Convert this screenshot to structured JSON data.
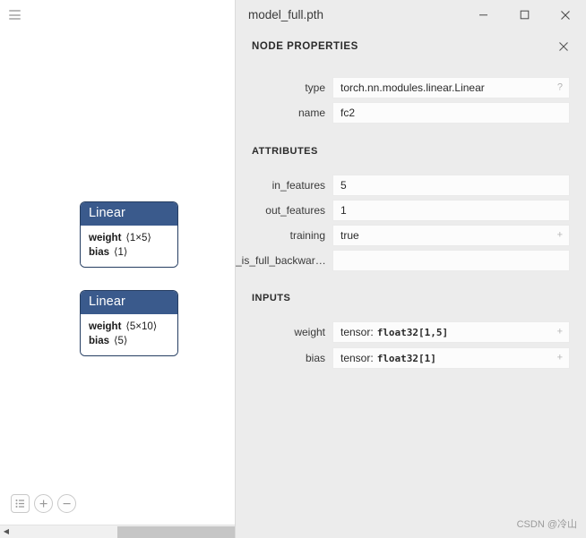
{
  "window": {
    "title": "model_full.pth",
    "minimize_label": "—",
    "maximize_label": "□",
    "close_label": "✕"
  },
  "canvas": {
    "menu_icon": "hamburger-icon",
    "toolbar": {
      "list_icon": "list-icon",
      "zoom_in_label": "+",
      "zoom_out_label": "−"
    },
    "scrollbar": {
      "left_arrow": "◀",
      "right_arrow": "▶"
    },
    "nodes": [
      {
        "title": "Linear",
        "attributes": [
          {
            "key": "weight",
            "value": "⟨1×5⟩"
          },
          {
            "key": "bias",
            "value": "⟨1⟩"
          }
        ]
      },
      {
        "title": "Linear",
        "attributes": [
          {
            "key": "weight",
            "value": "⟨5×10⟩"
          },
          {
            "key": "bias",
            "value": "⟨5⟩"
          }
        ]
      }
    ]
  },
  "panel": {
    "header_title": "NODE PROPERTIES",
    "close_label": "✕",
    "top_fields": [
      {
        "label": "type",
        "value": "torch.nn.modules.linear.Linear",
        "affix": "?",
        "affix_name": "help-icon"
      },
      {
        "label": "name",
        "value": "fc2",
        "affix": "",
        "affix_name": ""
      }
    ],
    "attributes_section": {
      "title": "ATTRIBUTES",
      "fields": [
        {
          "label": "in_features",
          "value": "5",
          "affix": "",
          "affix_name": ""
        },
        {
          "label": "out_features",
          "value": "1",
          "affix": "",
          "affix_name": ""
        },
        {
          "label": "training",
          "value": "true",
          "affix": "+",
          "affix_name": "expand-icon"
        },
        {
          "label": "_is_full_backwar…",
          "value": "",
          "affix": "",
          "affix_name": ""
        }
      ]
    },
    "inputs_section": {
      "title": "INPUTS",
      "fields": [
        {
          "label": "weight",
          "prefix": "tensor:",
          "mono": "float32[1,5]",
          "affix": "+",
          "affix_name": "expand-icon"
        },
        {
          "label": "bias",
          "prefix": "tensor:",
          "mono": "float32[1]",
          "affix": "+",
          "affix_name": "expand-icon"
        }
      ]
    }
  },
  "watermark": "CSDN @冷山",
  "colors": {
    "node_header": "#3a5a8c",
    "node_border": "#253d61",
    "panel_bg": "#ececec",
    "field_bg": "#fcfcfc"
  }
}
